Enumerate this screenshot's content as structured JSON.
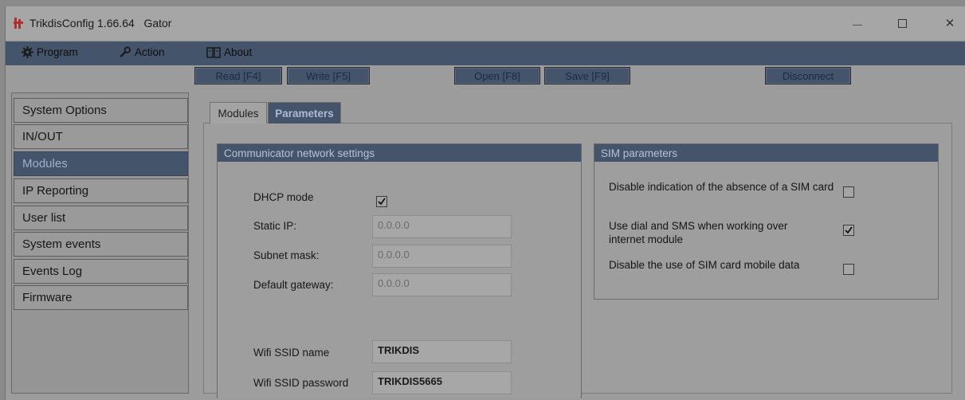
{
  "window": {
    "title": "TrikdisConfig 1.66.64   Gator",
    "controls": {
      "minimize": "minimize",
      "maximize": "maximize",
      "close": "✕"
    }
  },
  "menu": {
    "program": "Program",
    "action": "Action",
    "about": "About"
  },
  "toolbar": {
    "read": "Read [F4]",
    "write": "Write [F5]",
    "open": "Open [F8]",
    "save": "Save [F9]",
    "disconnect": "Disconnect"
  },
  "sidebar": {
    "items": [
      {
        "label": "System Options",
        "active": false
      },
      {
        "label": "IN/OUT",
        "active": false
      },
      {
        "label": "Modules",
        "active": true
      },
      {
        "label": "IP Reporting",
        "active": false
      },
      {
        "label": "User list",
        "active": false
      },
      {
        "label": "System events",
        "active": false
      },
      {
        "label": "Events Log",
        "active": false
      },
      {
        "label": "Firmware",
        "active": false
      }
    ]
  },
  "tabs": {
    "modules": "Modules",
    "parameters": "Parameters",
    "active": "Parameters"
  },
  "network": {
    "title": "Communicator network settings",
    "dhcp_label": "DHCP mode",
    "dhcp_checked": true,
    "static_ip_label": "Static IP:",
    "static_ip_value": "0.0.0.0",
    "subnet_label": "Subnet mask:",
    "subnet_value": "0.0.0.0",
    "gateway_label": "Default gateway:",
    "gateway_value": "0.0.0.0",
    "ssid_label": "Wifi SSID name",
    "ssid_value": "TRIKDIS",
    "password_label": "Wifi SSID password",
    "password_value": "TRIKDIS5665"
  },
  "sim": {
    "title": "SIM parameters",
    "options": [
      {
        "label": "Disable indication of the absence of a SIM card",
        "checked": false
      },
      {
        "label": "Use dial and SMS when working over internet module",
        "checked": true
      },
      {
        "label": "Disable the use of SIM card mobile data",
        "checked": false
      }
    ]
  },
  "colors": {
    "accent": "#44546a",
    "accent_text": "#a9bcd4",
    "window_bg": "#9c9c9c"
  }
}
